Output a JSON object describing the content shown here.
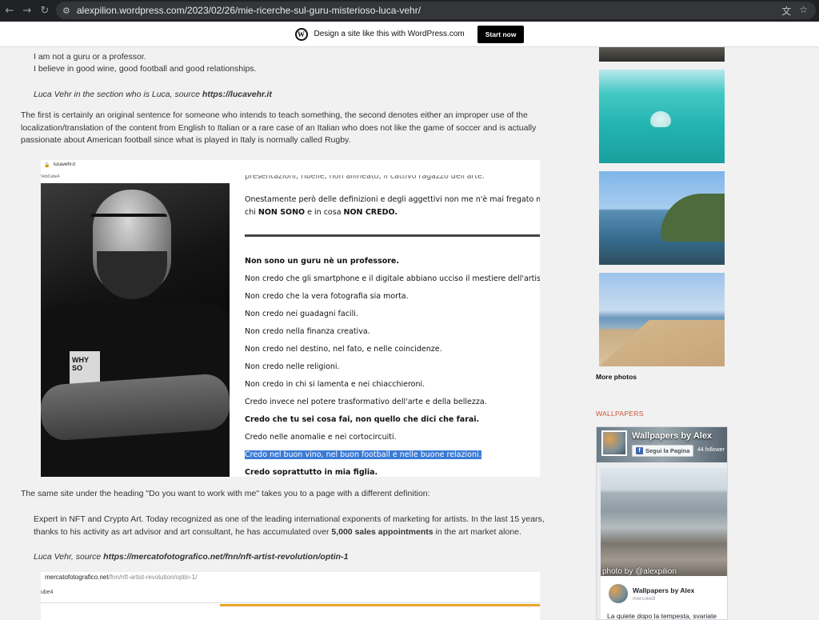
{
  "browser": {
    "url": "alexpilion.wordpress.com/2023/02/26/mie-ricerche-sul-guru-misterioso-luca-vehr/"
  },
  "wpbar": {
    "text": "Design a site like this with WordPress.com",
    "start_label": "Start now"
  },
  "article": {
    "quote1_lines": [
      "I am not a guru or a professor.",
      "I believe in good wine, good football and good relationships."
    ],
    "quote1_source": "Luca Vehr in the section who is Luca, source ",
    "quote1_source_link": "https://lucavehr.it",
    "para1": "The first is certainly an original sentence for someone who intends to teach something, the second denotes either an improper use of the localization/translation of the content from English to Italian or a rare case of an Italian who does not like the game of soccer and is actually passionate about American football since what is played in Italy is normally called Rugby.",
    "para2": "The same site under the heading \"Do you want to work with me\" takes you to a page with a different definition:",
    "quote2_a": "Expert in NFT and Crypto Art. Today recognized as one of the leading international exponents of marketing for artists. In the last 15 years, thanks to his activity as art advisor and art consultant, he has accumulated over ",
    "quote2_bold": "5,000 sales appointments",
    "quote2_b": " in the art market alone.",
    "quote2_source": "Luca Vehr, source ",
    "quote2_source_link": "https://mercatofotografico.net/fnn/nft-artist-revolution/optin-1"
  },
  "shot1": {
    "domain": "lucavehr.it",
    "tab": "VebCube4",
    "cut_text": "presentazioni, ribelle, non allineato, il cattivo ragazzo dell'arte.",
    "line_a": "Onestamente però delle definizioni e degli aggettivi non me n'è mai fregato molto",
    "line_b1": "chi ",
    "line_b2": "NON SONO",
    "line_b3": " e in cosa ",
    "line_b4": "NON CREDO.",
    "book_text": "WHY SO",
    "items": [
      {
        "text": "Non sono un guru nè un professore.",
        "bold": true,
        "hl": false
      },
      {
        "text": "Non credo che gli smartphone e il digitale abbiano ucciso il mestiere dell'artista.",
        "bold": false,
        "hl": false
      },
      {
        "text": "Non credo che la vera fotografia sia morta.",
        "bold": false,
        "hl": false
      },
      {
        "text": "Non credo nei guadagni facili.",
        "bold": false,
        "hl": false
      },
      {
        "text": "Non credo nella finanza creativa.",
        "bold": false,
        "hl": false
      },
      {
        "text": "Non credo nel destino, nel fato, e nelle coincidenze.",
        "bold": false,
        "hl": false
      },
      {
        "text": "Non credo nelle religioni.",
        "bold": false,
        "hl": false
      },
      {
        "text": "Non credo in chi si lamenta e nei chiacchieroni.",
        "bold": false,
        "hl": false
      },
      {
        "text": "Credo invece nel potere trasformativo dell'arte e della bellezza.",
        "bold": false,
        "hl": false
      },
      {
        "text": "Credo che tu sei cosa fai, non quello che dici che farai.",
        "bold": true,
        "hl": false
      },
      {
        "text": "Credo nelle anomalie e nei cortocircuiti.",
        "bold": false,
        "hl": false
      },
      {
        "text": "Credo nel buon vino, nel buon football e nelle buone relazioni.",
        "bold": false,
        "hl": true
      },
      {
        "text": "Credo soprattutto in mia figlia.",
        "bold": true,
        "hl": false
      }
    ]
  },
  "shot2": {
    "domain": "mercatofotografico.net",
    "path": "/fnn/nft-artist-revolution/optin-1/",
    "tab": "ube4"
  },
  "sidebar": {
    "more_photos": "More photos",
    "wallpapers_title": "WALLPAPERS",
    "fb": {
      "page_name": "Wallpapers by Alex",
      "follow_label": "Segui la Pagina",
      "followers": "44 follower",
      "caption": "photo by @alexpilion",
      "post_author": "Wallpapers by Alex",
      "post_day": "mercoledì",
      "post_text": "La quiete dopo la tempesta, svariate"
    }
  }
}
